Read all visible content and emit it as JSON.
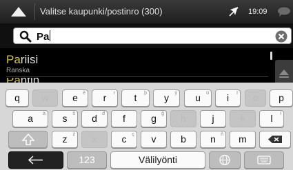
{
  "header": {
    "title": "Valitse kaupunki/postinro (300)",
    "time": "19:09"
  },
  "search": {
    "value": "Pa"
  },
  "results": [
    {
      "match": "Pa",
      "rest": "riisi",
      "country": "Ranska"
    },
    {
      "match": "Pa",
      "rest": "ntin",
      "country": ""
    }
  ],
  "keyboard": {
    "row1": [
      {
        "label": "q",
        "alt": ""
      },
      {
        "label": "w",
        "alt": ""
      },
      {
        "label": "e",
        "alt": "è"
      },
      {
        "label": "r",
        "alt": "r̂"
      },
      {
        "label": "t",
        "alt": "þ"
      },
      {
        "label": "y",
        "alt": "ý"
      },
      {
        "label": "u",
        "alt": "ü"
      },
      {
        "label": "i",
        "alt": "ï"
      },
      {
        "label": "o",
        "alt": ""
      },
      {
        "label": "p",
        "alt": ""
      }
    ],
    "row2": [
      {
        "label": "a",
        "alt": "à"
      },
      {
        "label": "s",
        "alt": "š"
      },
      {
        "label": "d",
        "alt": "đ"
      },
      {
        "label": "f",
        "alt": ""
      },
      {
        "label": "g",
        "alt": "ğ"
      },
      {
        "label": "h",
        "alt": ""
      },
      {
        "label": "j",
        "alt": ""
      },
      {
        "label": "k",
        "alt": ""
      },
      {
        "label": "l",
        "alt": "ł"
      }
    ],
    "row3": [
      {
        "label": "z",
        "alt": "ž"
      },
      {
        "label": "x",
        "alt": ""
      },
      {
        "label": "c",
        "alt": "ç"
      },
      {
        "label": "v",
        "alt": ""
      },
      {
        "label": "b",
        "alt": ""
      },
      {
        "label": "n",
        "alt": "ñ"
      },
      {
        "label": "m",
        "alt": ""
      }
    ],
    "numbers_label": "123",
    "space_label": "Välilyönti"
  },
  "icons": {
    "back": "back-triangle-icon",
    "gps": "no-gps-icon",
    "message": "message-icon",
    "search": "search-icon",
    "clear": "clear-icon",
    "shift": "shift-icon",
    "backspace": "backspace-icon",
    "enter": "arrow-left-icon",
    "language": "globe-icon",
    "hide_keyboard": "keyboard-icon"
  },
  "colors": {
    "highlight": "#d8c840",
    "background": "#000000",
    "keyboard": "#d7d7d7"
  }
}
